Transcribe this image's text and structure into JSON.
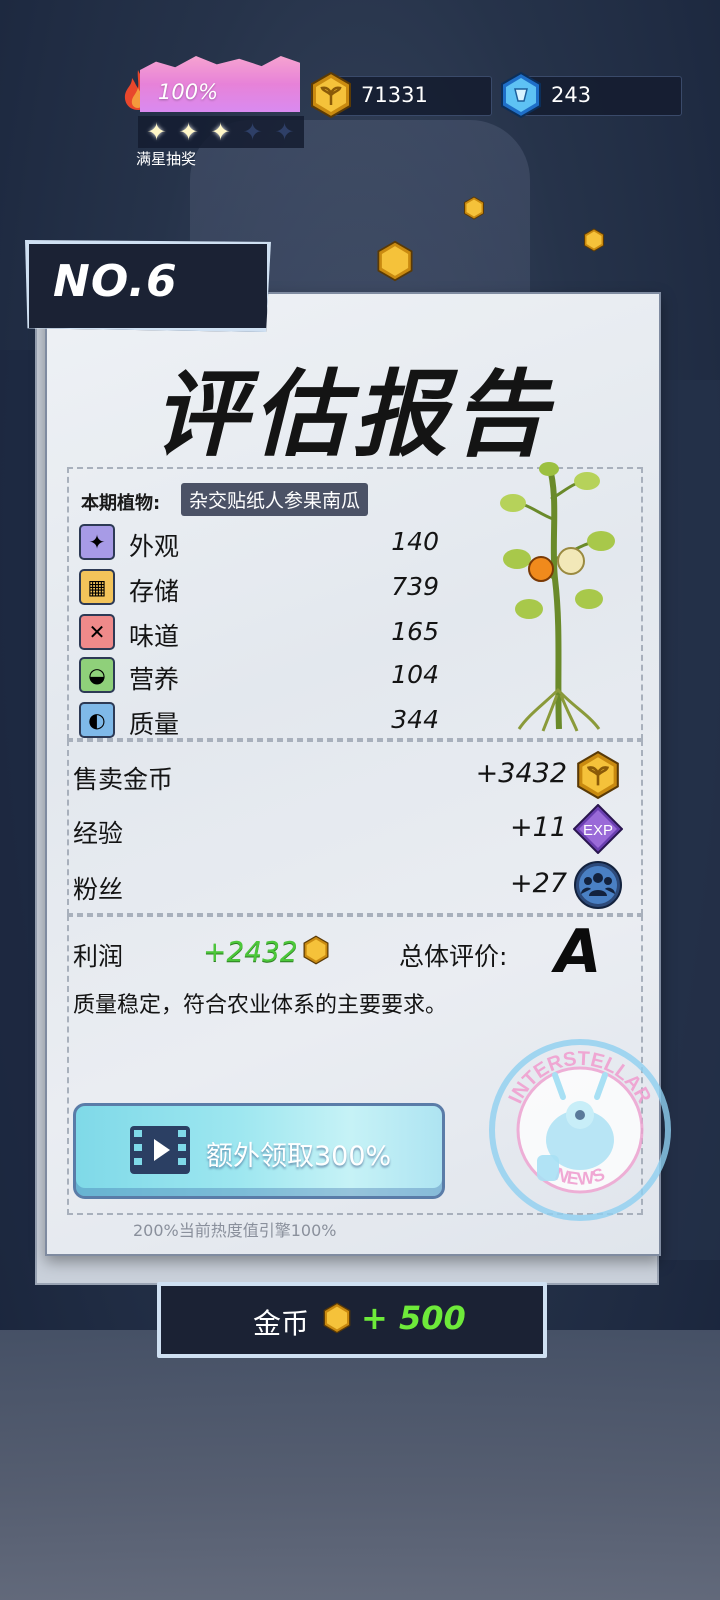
{
  "hud": {
    "energy_percent": "100%",
    "energy_fill": 1.0,
    "stars_filled": 3,
    "stars_total": 5,
    "energy_label": "满星抽奖",
    "coins": "71331",
    "gems": "243"
  },
  "report": {
    "number": "NO.6",
    "title": "评估报告",
    "plant_label": "本期植物:",
    "plant_name": "杂交贴纸人参果南瓜",
    "stats": [
      {
        "icon": "sparkle-icon",
        "label": "外观",
        "value": "140",
        "color": "#a79be6"
      },
      {
        "icon": "storage-box-icon",
        "label": "存储",
        "value": "739",
        "color": "#f3c45a"
      },
      {
        "icon": "fork-knife-icon",
        "label": "味道",
        "value": "165",
        "color": "#ef8a8a"
      },
      {
        "icon": "nutrition-bowl-icon",
        "label": "营养",
        "value": "104",
        "color": "#8fd07a"
      },
      {
        "icon": "muscle-arm-icon",
        "label": "质量",
        "value": "344",
        "color": "#7fb9e8"
      }
    ],
    "rewards": [
      {
        "label": "售卖金币",
        "value": "+3432",
        "icon": "coin-icon"
      },
      {
        "label": "经验",
        "value": "+11",
        "icon": "exp-badge-icon",
        "icon_text": "EXP"
      },
      {
        "label": "粉丝",
        "value": "+27",
        "icon": "fans-icon"
      }
    ],
    "profit_label": "利润",
    "profit_value": "+2432",
    "overall_label": "总体评价:",
    "overall_grade": "A",
    "comment": "质量稳定，符合农业体系的主要要求。",
    "extra_button": "额外领取300%",
    "extra_note": "200%当前热度值引擎100%",
    "stamp_text_top": "INTERSTELLAR",
    "stamp_text_bottom": "NEWS"
  },
  "footer": {
    "label": "金币",
    "value": "+ 500"
  },
  "colors": {
    "accent_green": "#6eea3a",
    "profit_green": "#4cc73a",
    "dark_panel": "#1b2234",
    "coin_gold": "#f2b51c"
  }
}
